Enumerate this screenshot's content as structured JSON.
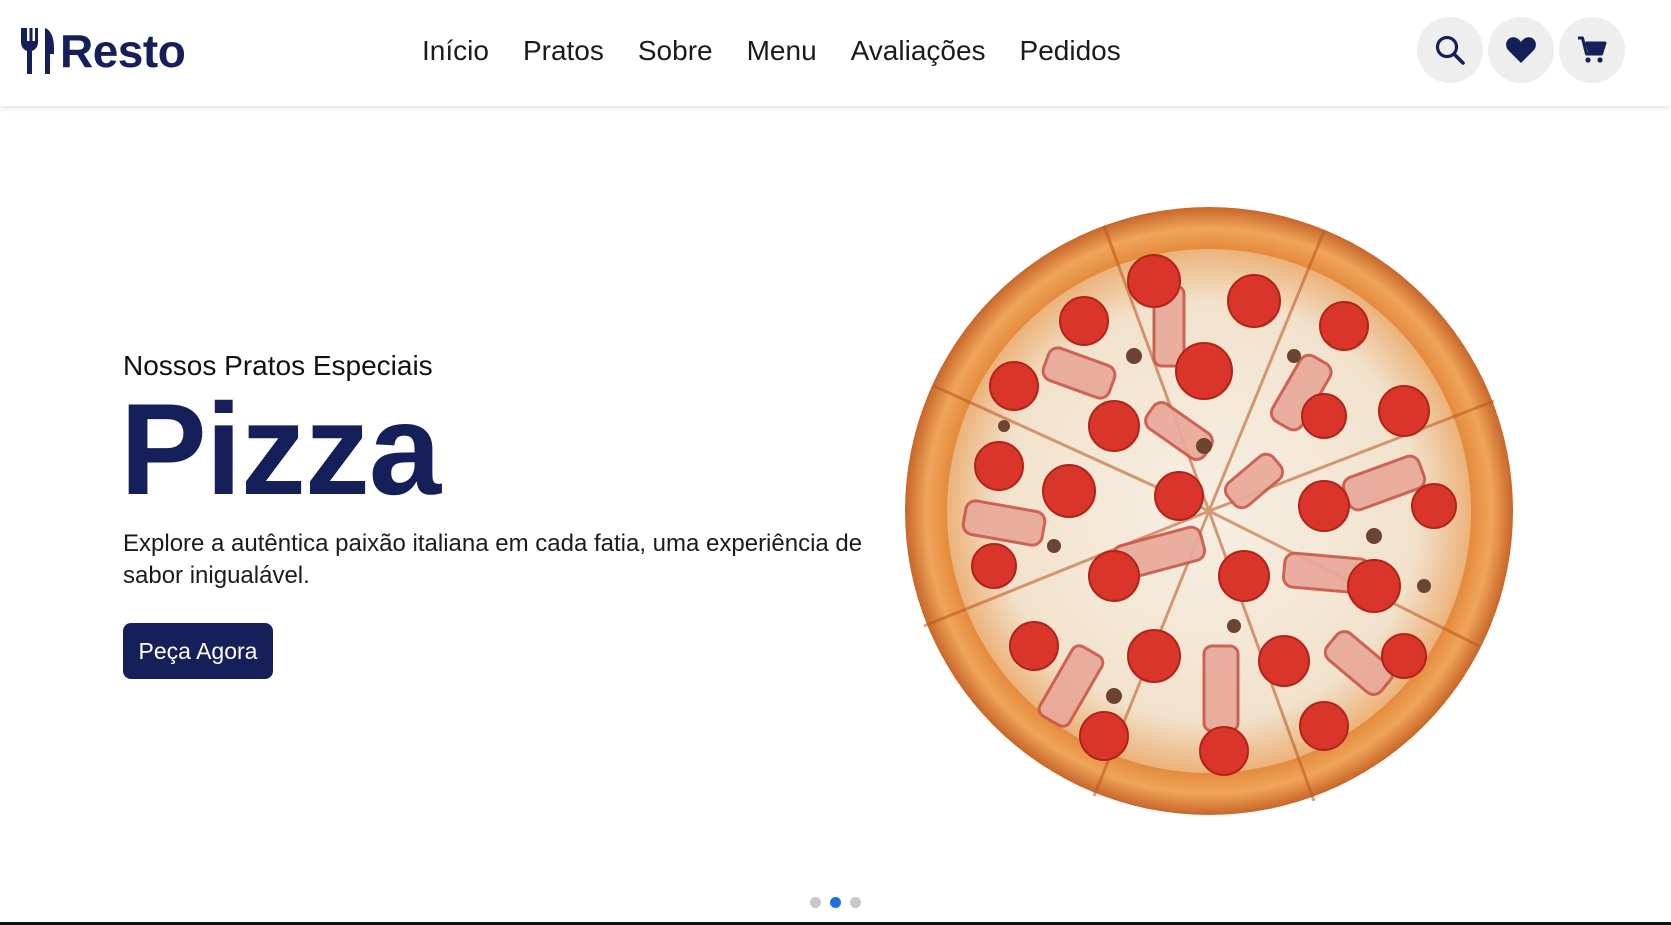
{
  "brand": {
    "name": "Resto",
    "logo_icon": "fork-knife-icon",
    "color": "#15205a"
  },
  "nav": {
    "items": [
      {
        "label": "Início"
      },
      {
        "label": "Pratos"
      },
      {
        "label": "Sobre"
      },
      {
        "label": "Menu"
      },
      {
        "label": "Avaliações"
      },
      {
        "label": "Pedidos"
      }
    ],
    "icons": [
      "search-icon",
      "heart-icon",
      "cart-icon"
    ]
  },
  "hero": {
    "subtitle": "Nossos Pratos Especiais",
    "title": "Pizza",
    "description": "Explore a autêntica paixão italiana em cada fatia, uma experiência de sabor inigualável.",
    "button_label": "Peça Agora",
    "image": "pizza-image"
  },
  "slider": {
    "slide_count": 3,
    "active_index": 1,
    "active_color": "#1f6fe0",
    "inactive_color": "#c8c8c8"
  }
}
